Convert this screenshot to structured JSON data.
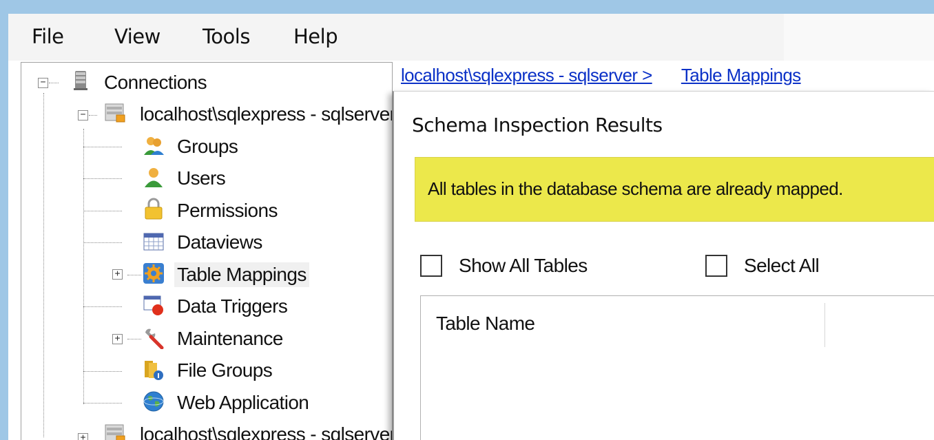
{
  "menu": {
    "file": "File",
    "view": "View",
    "tools": "Tools",
    "help": "Help"
  },
  "tree": {
    "root": "Connections",
    "connection1": "localhost\\sqlexpress - sqlserver",
    "children": [
      {
        "label": "Groups",
        "icon": "groups-icon"
      },
      {
        "label": "Users",
        "icon": "user-icon"
      },
      {
        "label": "Permissions",
        "icon": "lock-icon"
      },
      {
        "label": "Dataviews",
        "icon": "table-grid-icon"
      },
      {
        "label": "Table Mappings",
        "icon": "gear-icon",
        "selected": true
      },
      {
        "label": "Data Triggers",
        "icon": "trigger-icon"
      },
      {
        "label": "Maintenance",
        "icon": "wrench-icon"
      },
      {
        "label": "File Groups",
        "icon": "file-groups-icon"
      },
      {
        "label": "Web Application",
        "icon": "globe-icon"
      }
    ],
    "connection2": "localhost\\sqlexpress - sqlserver"
  },
  "breadcrumb": {
    "server": "localhost\\sqlexpress - sqlserver >",
    "page": "Table Mappings"
  },
  "dialog": {
    "title": "Schema Inspection Results",
    "banner": "All tables in the database schema are already mapped.",
    "show_all_tables": "Show All Tables",
    "select_all": "Select All",
    "column_table_name": "Table Name"
  },
  "colors": {
    "link": "#0b31c7",
    "banner": "#ece84b",
    "desktop": "#9fc7e6"
  }
}
